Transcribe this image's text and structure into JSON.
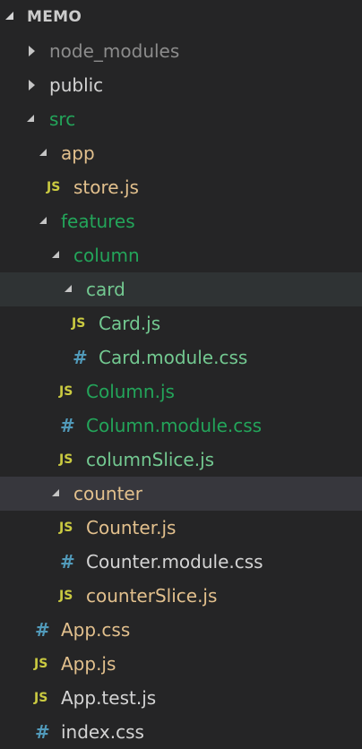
{
  "explorer": {
    "section_title": "MEMO"
  },
  "tree": {
    "node_modules": "node_modules",
    "public": "public",
    "src": "src",
    "app": "app",
    "store_js": "store.js",
    "features": "features",
    "column": "column",
    "card": "card",
    "card_js": "Card.js",
    "card_css": "Card.module.css",
    "column_js": "Column.js",
    "column_css": "Column.module.css",
    "columnslice_js": "columnSlice.js",
    "counter": "counter",
    "counter_js": "Counter.js",
    "counter_css": "Counter.module.css",
    "counterslice_js": "counterSlice.js",
    "app_css": "App.css",
    "app_js": "App.js",
    "app_test_js": "App.test.js",
    "index_css": "index.css"
  },
  "icons": {
    "js_label": "JS",
    "css_label": "#"
  },
  "colors": {
    "background": "#252526",
    "ignored": "#8c8c8c",
    "default": "#d4d4d4",
    "untracked": "#73c991",
    "modified": "#e2c08d",
    "js_icon": "#cbcb41",
    "css_icon": "#519aba"
  }
}
